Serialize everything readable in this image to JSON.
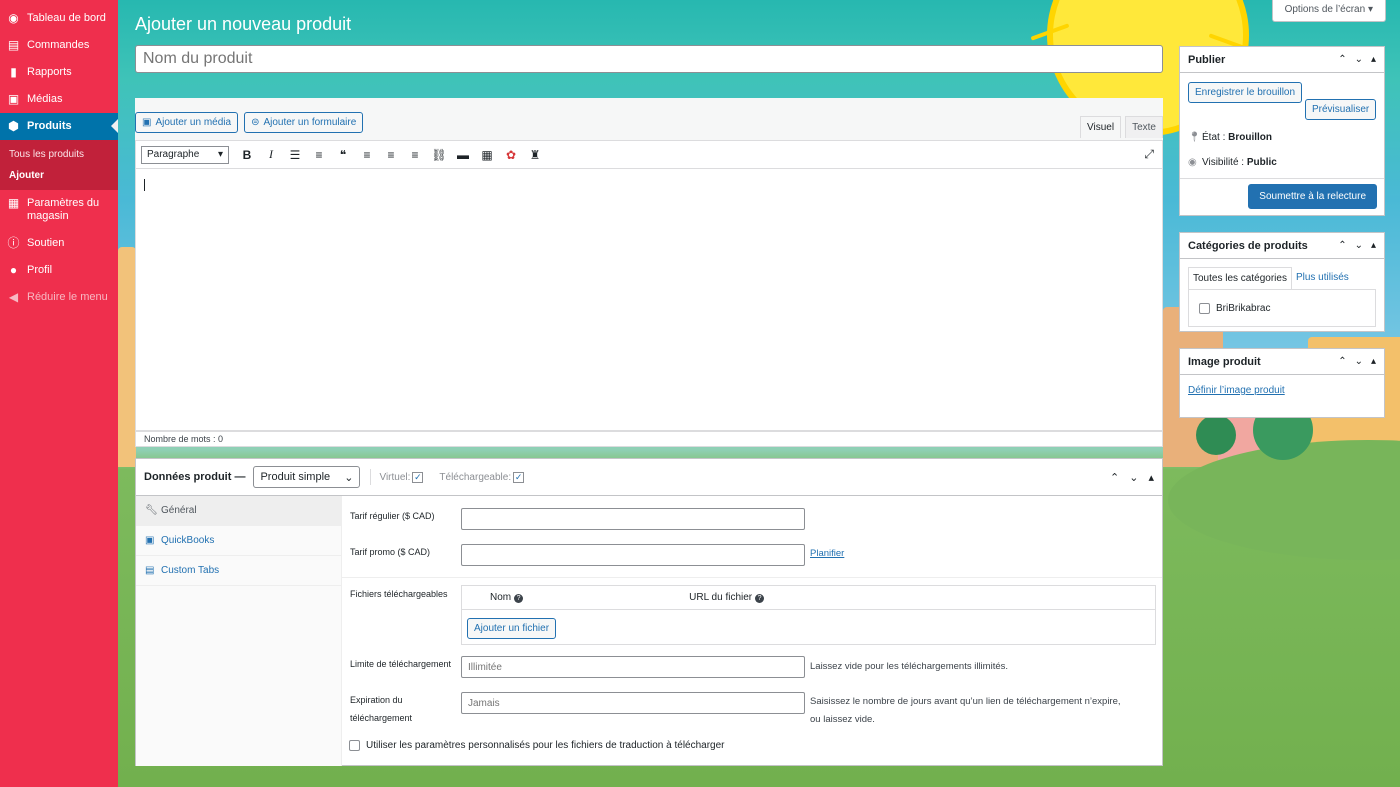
{
  "sidebar": {
    "items": [
      {
        "label": "Tableau de bord",
        "icon": "dashboard-icon"
      },
      {
        "label": "Commandes",
        "icon": "store-icon"
      },
      {
        "label": "Rapports",
        "icon": "chart-bar-icon"
      },
      {
        "label": "Médias",
        "icon": "media-icon"
      },
      {
        "label": "Produits",
        "icon": "box-icon"
      },
      {
        "label": "Paramètres du magasin",
        "icon": "settings-grid-icon"
      },
      {
        "label": "Soutien",
        "icon": "info-icon"
      },
      {
        "label": "Profil",
        "icon": "user-icon"
      },
      {
        "label": "Réduire le menu",
        "icon": "collapse-icon"
      }
    ],
    "submenu": [
      "Tous les produits",
      "Ajouter"
    ]
  },
  "header": {
    "title": "Ajouter un nouveau produit",
    "screen_options": "Options de l’écran"
  },
  "title_field": {
    "placeholder": "Nom du produit"
  },
  "editor": {
    "add_media": "Ajouter un média",
    "add_form": "Ajouter un formulaire",
    "tab_visual": "Visuel",
    "tab_text": "Texte",
    "format": "Paragraphe",
    "word_count": "Nombre de mots : 0"
  },
  "product_data": {
    "title": "Données produit —",
    "type": "Produit simple",
    "virtual_label": "Virtuel:",
    "downloadable_label": "Téléchargeable:",
    "tabs": [
      {
        "label": "Général",
        "icon": "wrench-icon"
      },
      {
        "label": "QuickBooks",
        "icon": "quickbooks-icon"
      },
      {
        "label": "Custom Tabs",
        "icon": "tabs-icon"
      }
    ],
    "regular_price_label": "Tarif régulier ($ CAD)",
    "sale_price_label": "Tarif promo ($ CAD)",
    "schedule_link": "Planifier",
    "downloadable_files_label": "Fichiers téléchargeables",
    "col_name": "Nom",
    "col_url": "URL du fichier",
    "add_file": "Ajouter un fichier",
    "download_limit_label": "Limite de téléchargement",
    "download_limit_placeholder": "Illimitée",
    "download_limit_help": "Laissez vide pour les téléchargements illimités.",
    "download_expiry_label_1": "Expiration du",
    "download_expiry_label_2": "téléchargement",
    "download_expiry_placeholder": "Jamais",
    "download_expiry_help_1": "Saisissez le nombre de jours avant qu’un lien de téléchargement n’expire,",
    "download_expiry_help_2": "ou laissez vide.",
    "custom_translation": "Utiliser les paramètres personnalisés pour les fichiers de traduction à télécharger"
  },
  "publish": {
    "title": "Publier",
    "save_draft": "Enregistrer le brouillon",
    "preview": "Prévisualiser",
    "status_label": "État :",
    "status_value": "Brouillon",
    "visibility_label": "Visibilité :",
    "visibility_value": "Public",
    "submit": "Soumettre à la relecture"
  },
  "categories": {
    "title": "Catégories de produits",
    "tab_all": "Toutes les catégories",
    "tab_popular": "Plus utilisés",
    "items": [
      "BriBrikabrac"
    ]
  },
  "product_image": {
    "title": "Image produit",
    "link": "Définir l’image produit"
  }
}
